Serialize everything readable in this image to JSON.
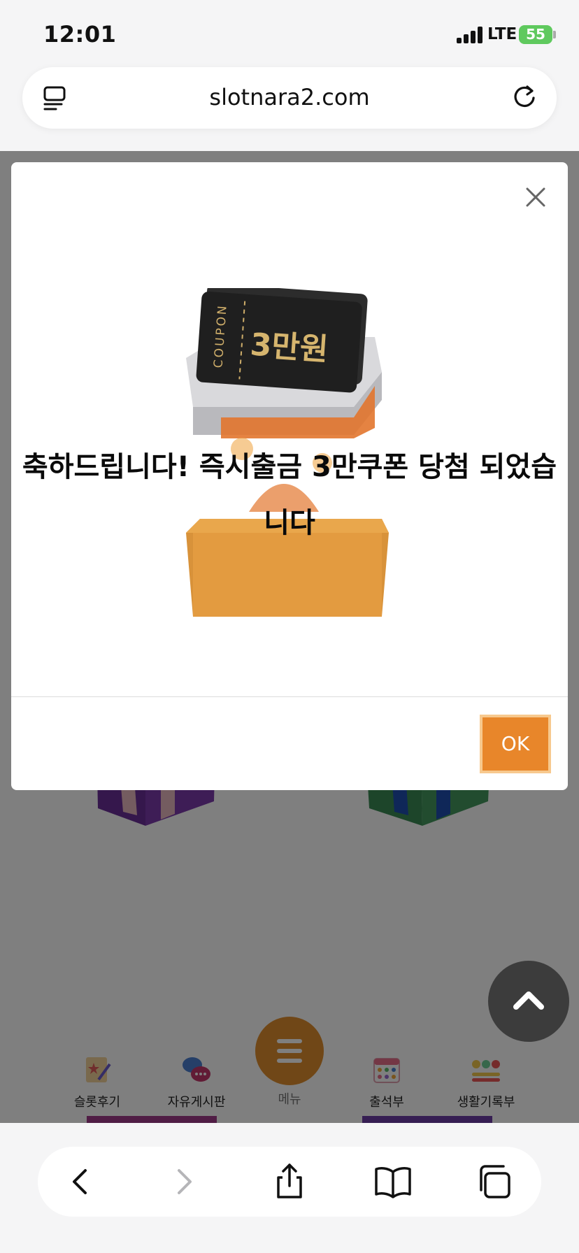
{
  "status_bar": {
    "time": "12:01",
    "network": "LTE",
    "battery": "55"
  },
  "browser": {
    "url": "slotnara2.com"
  },
  "modal": {
    "coupon_label": "COUPON",
    "coupon_amount": "3만원",
    "message_line1": "축하드립니다! 즉시출금 3만쿠폰 당첨 되었습",
    "message_line2": "니다",
    "ok_label": "OK"
  },
  "bottom_nav": {
    "items": [
      {
        "label": "슬롯후기",
        "icon": "review-icon"
      },
      {
        "label": "자유게시판",
        "icon": "chat-bubbles-icon"
      },
      {
        "label": "메뉴",
        "icon": "hamburger-icon"
      },
      {
        "label": "출석부",
        "icon": "calendar-icon"
      },
      {
        "label": "생활기록부",
        "icon": "emoji-record-icon"
      }
    ]
  },
  "colors": {
    "accent": "#e8862a",
    "ok_border": "#f7c98e",
    "battery": "#5fc95e"
  }
}
